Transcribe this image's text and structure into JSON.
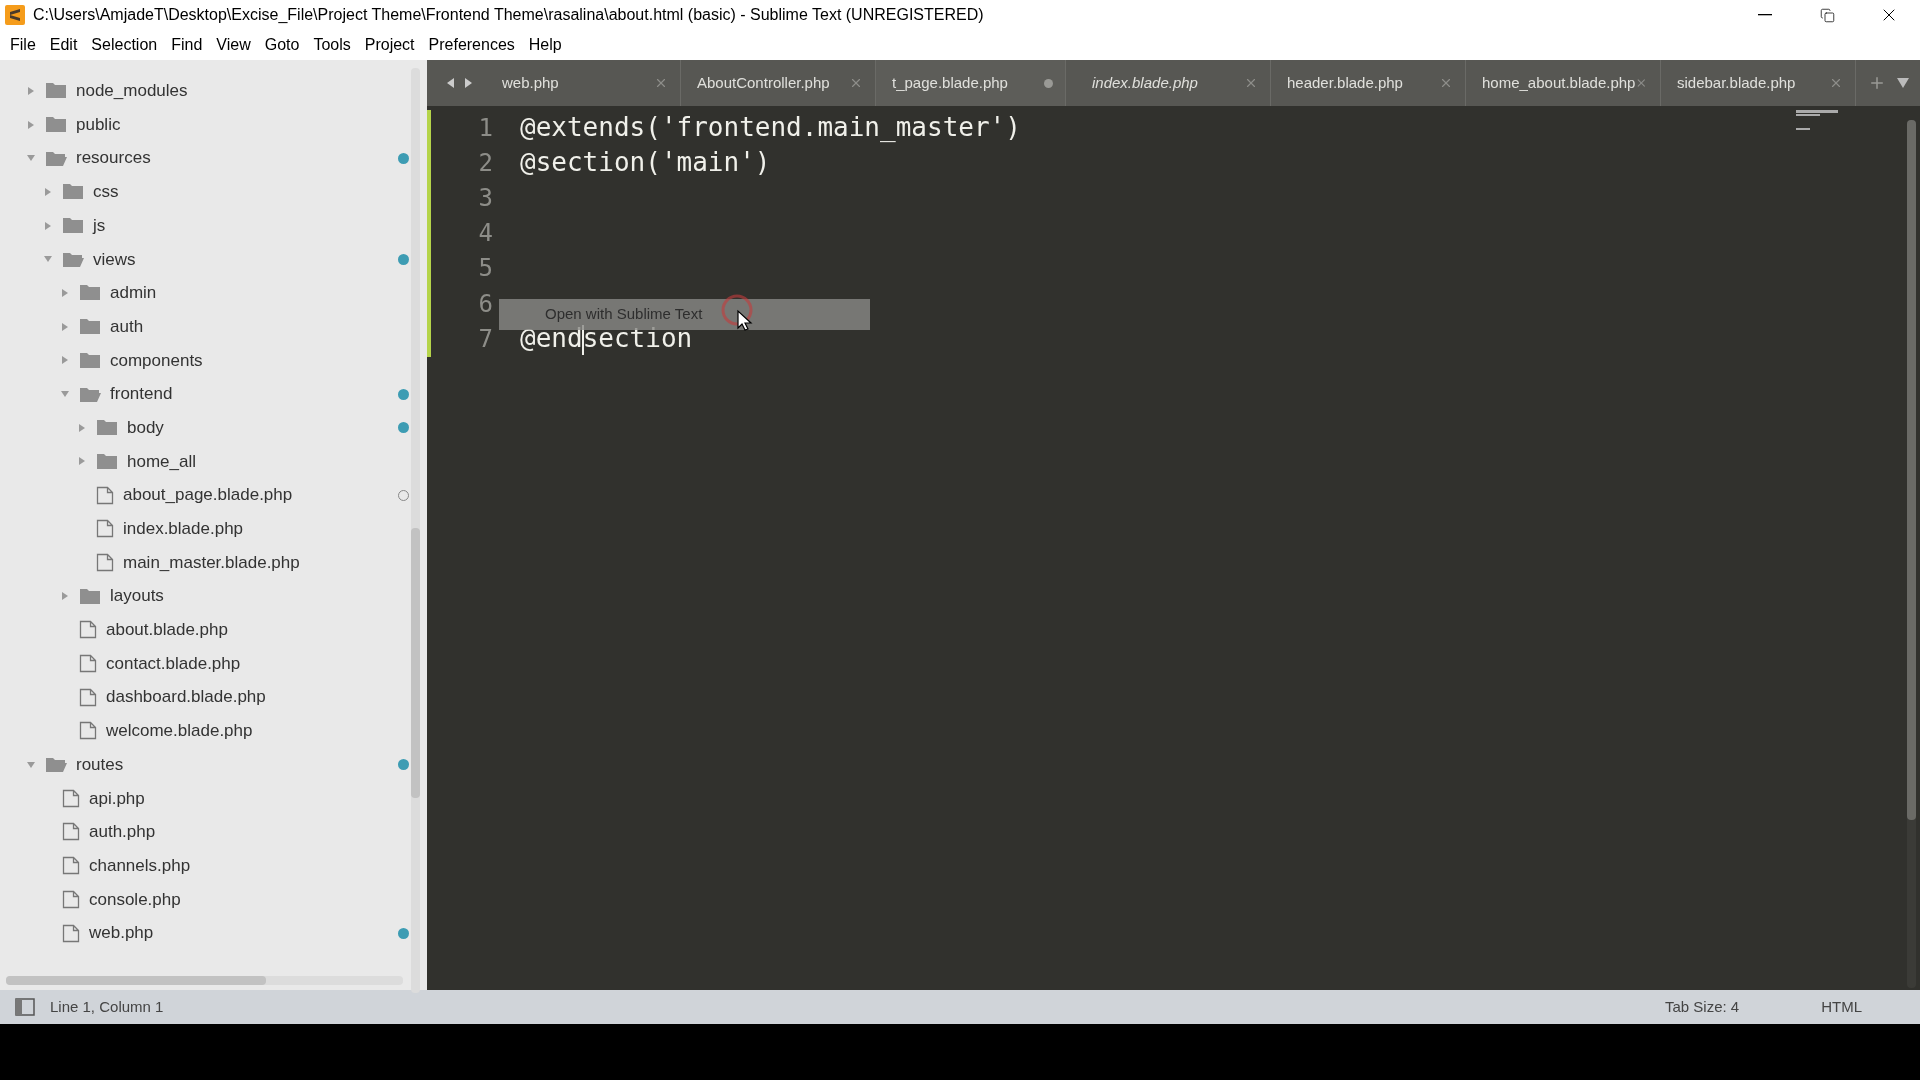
{
  "window": {
    "title": "C:\\Users\\AmjadeT\\Desktop\\Excise_File\\Project Theme\\Frontend Theme\\rasalina\\about.html (basic) - Sublime Text (UNREGISTERED)"
  },
  "menu": [
    "File",
    "Edit",
    "Selection",
    "Find",
    "View",
    "Goto",
    "Tools",
    "Project",
    "Preferences",
    "Help"
  ],
  "sidebar": {
    "items": [
      {
        "label": "node_modules",
        "expanded": false,
        "modified": false,
        "unsaved": false
      },
      {
        "label": "public",
        "expanded": false,
        "modified": false,
        "unsaved": false
      },
      {
        "label": "resources",
        "expanded": true,
        "modified": true,
        "unsaved": false,
        "children": [
          {
            "label": "css",
            "expanded": false,
            "modified": false,
            "unsaved": false
          },
          {
            "label": "js",
            "expanded": false,
            "modified": false,
            "unsaved": false
          },
          {
            "label": "views",
            "expanded": true,
            "modified": true,
            "unsaved": false,
            "children": [
              {
                "label": "admin",
                "expanded": false,
                "modified": false,
                "unsaved": false
              },
              {
                "label": "auth",
                "expanded": false,
                "modified": false,
                "unsaved": false
              },
              {
                "label": "components",
                "expanded": false,
                "modified": false,
                "unsaved": false
              },
              {
                "label": "frontend",
                "expanded": true,
                "modified": true,
                "unsaved": false,
                "children": [
                  {
                    "label": "body",
                    "expanded": false,
                    "modified": true,
                    "unsaved": false
                  },
                  {
                    "label": "home_all",
                    "expanded": false,
                    "modified": false,
                    "unsaved": false
                  },
                  {
                    "label": "about_page.blade.php",
                    "modified": false,
                    "unsaved": true
                  },
                  {
                    "label": "index.blade.php",
                    "modified": false,
                    "unsaved": false
                  },
                  {
                    "label": "main_master.blade.php",
                    "modified": false,
                    "unsaved": false
                  }
                ]
              },
              {
                "label": "layouts",
                "expanded": false,
                "modified": false,
                "unsaved": false
              },
              {
                "label": "about.blade.php",
                "modified": false,
                "unsaved": false
              },
              {
                "label": "contact.blade.php",
                "modified": false,
                "unsaved": false
              },
              {
                "label": "dashboard.blade.php",
                "modified": false,
                "unsaved": false
              },
              {
                "label": "welcome.blade.php",
                "modified": false,
                "unsaved": false
              }
            ]
          }
        ]
      },
      {
        "label": "routes",
        "expanded": true,
        "modified": true,
        "unsaved": false,
        "children": [
          {
            "label": "api.php",
            "modified": false,
            "unsaved": false
          },
          {
            "label": "auth.php",
            "modified": false,
            "unsaved": false
          },
          {
            "label": "channels.php",
            "modified": false,
            "unsaved": false
          },
          {
            "label": "console.php",
            "modified": false,
            "unsaved": false
          },
          {
            "label": "web.php",
            "modified": true,
            "unsaved": false
          }
        ]
      }
    ]
  },
  "tabs": [
    {
      "label": "web.php",
      "selected": false,
      "dirty": false,
      "preview": false
    },
    {
      "label": "AboutController.php",
      "selected": false,
      "dirty": false,
      "preview": false
    },
    {
      "label": "t_page.blade.php",
      "selected": true,
      "dirty": true,
      "preview": false
    },
    {
      "label": "index.blade.php",
      "selected": false,
      "dirty": false,
      "preview": true
    },
    {
      "label": "header.blade.php",
      "selected": false,
      "dirty": false,
      "preview": false
    },
    {
      "label": "home_about.blade.php",
      "selected": false,
      "dirty": false,
      "preview": false
    },
    {
      "label": "sidebar.blade.php",
      "selected": false,
      "dirty": false,
      "preview": false
    }
  ],
  "editor": {
    "lines": [
      {
        "number": "1",
        "text": "@extends('frontend.main_master')"
      },
      {
        "number": "2",
        "text": "@section('main')"
      },
      {
        "number": "3"
      },
      {
        "number": "4"
      },
      {
        "number": "5"
      },
      {
        "number": "6"
      },
      {
        "number": "7",
        "text_before_caret": "@end",
        "text_after_caret": "section"
      }
    ],
    "tooltip": "Open with Sublime Text"
  },
  "status_bar": {
    "position": "Line 1, Column 1",
    "tab_size": "Tab Size: 4",
    "syntax": "HTML"
  }
}
